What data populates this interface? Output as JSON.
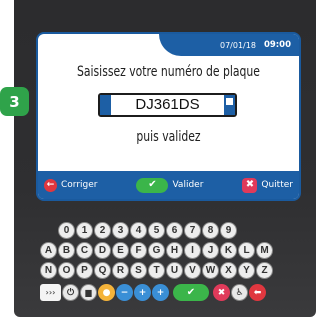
{
  "step_number": "3",
  "status": {
    "date": "07/01/18",
    "time": "09:00"
  },
  "screen": {
    "instruction_top": "Saisissez votre numéro de plaque",
    "plate_number": "DJ361DS",
    "instruction_bottom": "puis validez"
  },
  "actions": {
    "corriger": "Corriger",
    "valider": "Valider",
    "quitter": "Quitter"
  },
  "keypad": {
    "digits": [
      "0",
      "1",
      "2",
      "3",
      "4",
      "5",
      "6",
      "7",
      "8",
      "9"
    ],
    "letters_row1": [
      "A",
      "B",
      "C",
      "D",
      "E",
      "F",
      "G",
      "H",
      "I",
      "J",
      "K",
      "L",
      "M"
    ],
    "letters_row2": [
      "N",
      "O",
      "P",
      "Q",
      "R",
      "S",
      "T",
      "U",
      "V",
      "W",
      "X",
      "Y",
      "Z"
    ],
    "function_keys": {
      "arrows": "›››",
      "power": "⏻",
      "chat": "▆",
      "coin": "●",
      "minus": "−",
      "plus": "+",
      "plus_alt": "+",
      "validate": "✔",
      "cancel": "✖",
      "accessibility": "♿",
      "back": "⬅"
    }
  },
  "colors": {
    "bezel": "#2f2f31",
    "accent_blue": "#1d5fa5",
    "valid_green": "#3bb54a",
    "cancel_red": "#e03a5a",
    "step_green": "#2fa34a"
  }
}
